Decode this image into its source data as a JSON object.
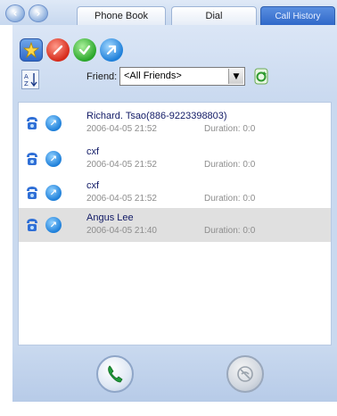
{
  "tabs": [
    {
      "label": "Phone Book"
    },
    {
      "label": "Dial"
    },
    {
      "label": "Call History"
    }
  ],
  "toolbar": {
    "friend_label": "Friend:",
    "friend_select": "<All Friends>"
  },
  "history": [
    {
      "name": "Richard. Tsao(886-9223398803)",
      "time": "2006-04-05 21:52",
      "duration": "Duration: 0:0"
    },
    {
      "name": "cxf",
      "time": "2006-04-05 21:52",
      "duration": "Duration: 0:0"
    },
    {
      "name": "cxf",
      "time": "2006-04-05 21:52",
      "duration": "Duration: 0:0"
    },
    {
      "name": "Angus Lee",
      "time": "2006-04-05 21:40",
      "duration": "Duration: 0:0"
    }
  ],
  "colors": {
    "accent": "#2f68c9",
    "panel": "#c9d9ef",
    "name_text": "#111a66"
  },
  "icons": {
    "back": "back-arrow-icon",
    "forward": "forward-arrow-icon",
    "call": "phone-call-icon",
    "hangup": "phone-hangup-icon"
  }
}
